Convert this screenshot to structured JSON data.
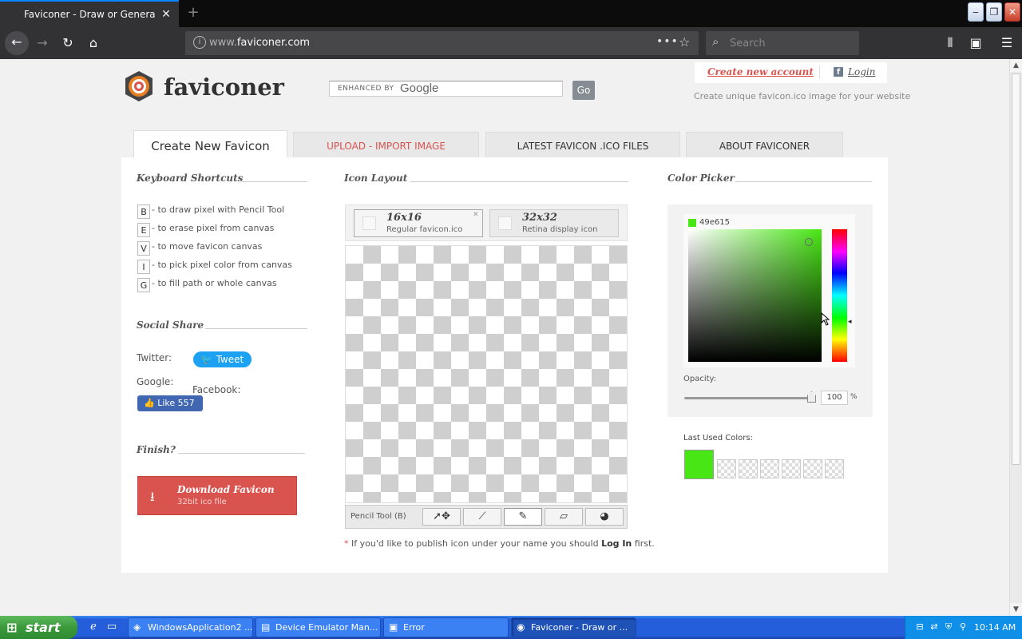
{
  "browser": {
    "tab_title": "Faviconer - Draw or Generate favicon",
    "url_domain": "www.",
    "url_rest": "faviconer.com",
    "search_placeholder": "Search"
  },
  "header": {
    "site_name": "faviconer",
    "google_enhanced": "ENHANCED BY",
    "google_word": "Google",
    "go_label": "Go",
    "create_account": "Create new account",
    "login": "Login",
    "tagline": "Create unique favicon.ico image for your website"
  },
  "tabs": [
    {
      "label": "Create New Favicon"
    },
    {
      "label": "UPLOAD - IMPORT IMAGE"
    },
    {
      "label": "LATEST FAVICON .ICO FILES"
    },
    {
      "label": "ABOUT FAVICONER"
    }
  ],
  "shortcuts": {
    "title": "Keyboard Shortcuts",
    "items": [
      {
        "key": "B",
        "desc": "- to draw pixel with Pencil Tool"
      },
      {
        "key": "E",
        "desc": "- to erase pixel from canvas"
      },
      {
        "key": "V",
        "desc": "- to move favicon canvas"
      },
      {
        "key": "I",
        "desc": "- to pick pixel color from canvas"
      },
      {
        "key": "G",
        "desc": "- to fill path or whole canvas"
      }
    ]
  },
  "social": {
    "title": "Social Share",
    "twitter_label": "Twitter:",
    "tweet_label": "Tweet",
    "google_label": "Google:",
    "facebook_label": "Facebook:",
    "like_label": "Like 557"
  },
  "finish": {
    "title": "Finish?",
    "download_label": "Download Favicon",
    "download_sub": "32bit ico file"
  },
  "icon_layout": {
    "title": "Icon Layout",
    "size16_name": "16x16",
    "size16_sub": "Regular favicon.ico",
    "size32_name": "32x32",
    "size32_sub": "Retina display icon",
    "tool_label": "Pencil Tool (B)",
    "publish_pre": " If you'd like to publish icon under your name you should ",
    "publish_link": "Log In",
    "publish_post": " first."
  },
  "color_picker": {
    "title": "Color Picker",
    "current_hex": "49e615",
    "current_color": "#49e615",
    "opacity_label": "Opacity:",
    "opacity_value": "100",
    "opacity_unit": "%",
    "last_used_label": "Last Used Colors:"
  },
  "taskbar": {
    "start": "start",
    "tasks": [
      {
        "label": "WindowsApplication2 ..."
      },
      {
        "label": "Device Emulator Man..."
      },
      {
        "label": "Error"
      },
      {
        "label": "Faviconer - Draw or ..."
      }
    ],
    "clock": "10:14 AM"
  }
}
